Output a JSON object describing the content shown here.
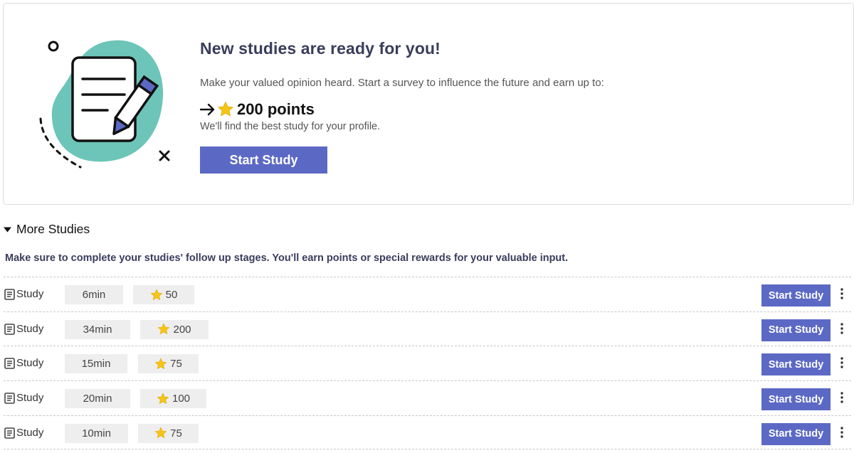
{
  "hero": {
    "title": "New studies are ready for you!",
    "description": "Make your valued opinion heard. Start a survey to influence the future and earn up to:",
    "points_label": "200 points",
    "subtext": "We'll find the best study for your profile.",
    "button_label": "Start Study"
  },
  "more": {
    "title": "More Studies",
    "note": "Make sure to complete your studies' follow up stages. You'll earn points or special rewards for your valuable input."
  },
  "studies": [
    {
      "type": "Study",
      "duration": "6min",
      "points": "50",
      "button": "Start Study"
    },
    {
      "type": "Study",
      "duration": "34min",
      "points": "200",
      "button": "Start Study"
    },
    {
      "type": "Study",
      "duration": "15min",
      "points": "75",
      "button": "Start Study"
    },
    {
      "type": "Study",
      "duration": "20min",
      "points": "100",
      "button": "Start Study"
    },
    {
      "type": "Study",
      "duration": "10min",
      "points": "75",
      "button": "Start Study"
    }
  ],
  "colors": {
    "accent": "#5c69c4",
    "title": "#3a3d5c",
    "blob": "#6cc5b8",
    "star": "#f5c518",
    "chip": "#eeeeee"
  },
  "icons": {
    "illustration": "document-pencil-illustration",
    "arrow": "arrow-right-icon",
    "star": "star-icon",
    "caret": "caret-down-icon",
    "doc": "document-icon",
    "kebab": "kebab-menu-icon"
  }
}
